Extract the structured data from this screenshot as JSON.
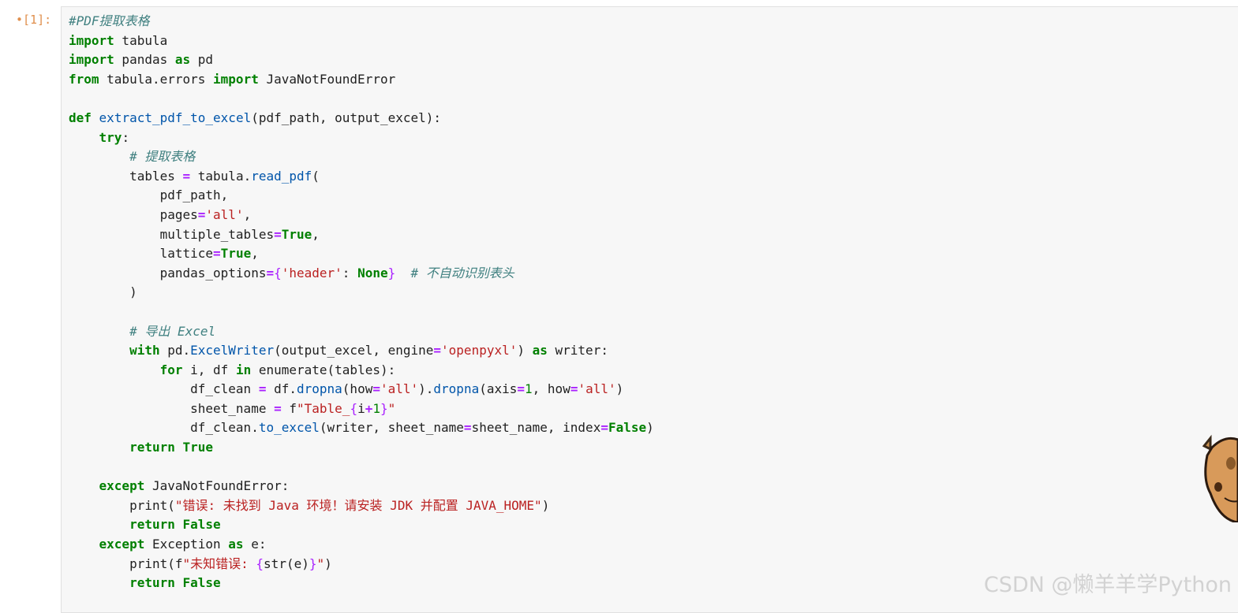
{
  "cell": {
    "prompt_dot": "•",
    "prompt_label": "[1]:"
  },
  "code": {
    "l01": "#PDF提取表格",
    "l02_kw": "import",
    "l02_rest": " tabula",
    "l03_kw": "import",
    "l03_mid": " pandas ",
    "l03_kw2": "as",
    "l03_rest": " pd",
    "l04_kw": "from",
    "l04_mid": " tabula.errors ",
    "l04_kw2": "import",
    "l04_rest": " JavaNotFoundError",
    "l06_kw": "def",
    "l06_fn": "extract_pdf_to_excel",
    "l06_rest": "(pdf_path, output_excel):",
    "l07_kw": "try",
    "l07_rest": ":",
    "l08_cm": "# 提取表格",
    "l09_a": "tables ",
    "l09_op": "=",
    "l09_b": " tabula.",
    "l09_fn": "read_pdf",
    "l09_c": "(",
    "l10": "pdf_path,",
    "l11_a": "pages",
    "l11_op": "=",
    "l11_str": "'all'",
    "l11_c": ",",
    "l12_a": "multiple_tables",
    "l12_op": "=",
    "l12_kw": "True",
    "l12_c": ",",
    "l13_a": "lattice",
    "l13_op": "=",
    "l13_kw": "True",
    "l13_c": ",",
    "l14_a": "pandas_options",
    "l14_op": "=",
    "l14_br1": "{",
    "l14_str": "'header'",
    "l14_b": ": ",
    "l14_kw": "None",
    "l14_br2": "}",
    "l14_cm": "  # 不自动识别表头",
    "l15": ")",
    "l17_cm": "# 导出 Excel",
    "l18_kw": "with",
    "l18_a": " pd.",
    "l18_fn": "ExcelWriter",
    "l18_b": "(output_excel, engine",
    "l18_op": "=",
    "l18_str": "'openpyxl'",
    "l18_c": ") ",
    "l18_kw2": "as",
    "l18_d": " writer:",
    "l19_kw": "for",
    "l19_a": " i, df ",
    "l19_kw2": "in",
    "l19_b": " enumerate(tables):",
    "l20_a": "df_clean ",
    "l20_op": "=",
    "l20_b": " df.",
    "l20_fn": "dropna",
    "l20_c": "(how",
    "l20_op2": "=",
    "l20_str": "'all'",
    "l20_d": ").",
    "l20_fn2": "dropna",
    "l20_e": "(axis",
    "l20_op3": "=",
    "l20_num": "1",
    "l20_f": ", how",
    "l20_op4": "=",
    "l20_str2": "'all'",
    "l20_g": ")",
    "l21_a": "sheet_name ",
    "l21_op": "=",
    "l21_b": " f",
    "l21_str": "\"Table_",
    "l21_br1": "{",
    "l21_c": "i",
    "l21_op2": "+",
    "l21_num": "1",
    "l21_br2": "}",
    "l21_str2": "\"",
    "l22_a": "df_clean.",
    "l22_fn": "to_excel",
    "l22_b": "(writer, sheet_name",
    "l22_op": "=",
    "l22_c": "sheet_name, index",
    "l22_op2": "=",
    "l22_kw": "False",
    "l22_d": ")",
    "l23_kw": "return",
    "l23_kw2": " True",
    "l25_kw": "except",
    "l25_rest": " JavaNotFoundError:",
    "l26_a": "print(",
    "l26_str": "\"错误: 未找到 Java 环境！请安装 JDK 并配置 JAVA_HOME\"",
    "l26_b": ")",
    "l27_kw": "return",
    "l27_kw2": " False",
    "l28_kw": "except",
    "l28_a": " Exception ",
    "l28_kw2": "as",
    "l28_b": " e:",
    "l29_a": "print(f",
    "l29_str": "\"未知错误: ",
    "l29_br1": "{",
    "l29_b": "str(e)",
    "l29_br2": "}",
    "l29_str2": "\"",
    "l29_c": ")",
    "l30_kw": "return",
    "l30_kw2": " False"
  },
  "watermark": "CSDN @懒羊羊学Python",
  "colors": {
    "keyword": "#008000",
    "operator": "#aa22ff",
    "string": "#ba2121",
    "comment": "#408080",
    "function": "#0055aa",
    "prompt": "#e0904e",
    "cell_background": "#f7f7f7"
  }
}
